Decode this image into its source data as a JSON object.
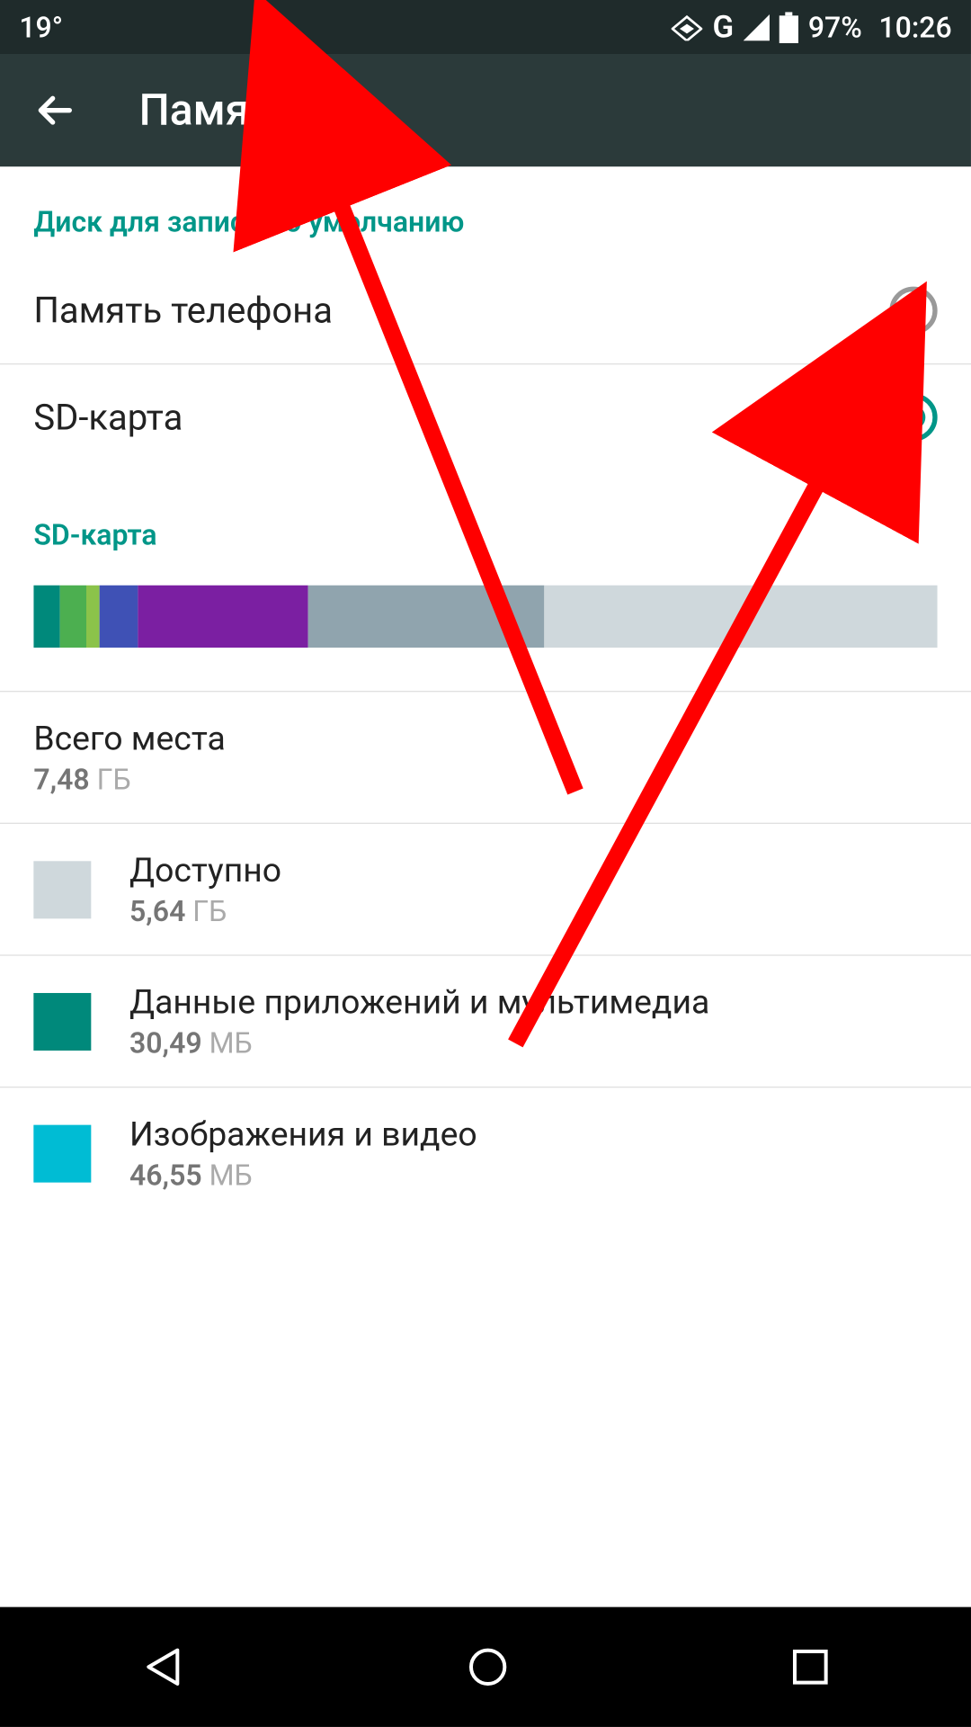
{
  "status": {
    "temperature": "19°",
    "battery_pct": "97%",
    "time": "10:26"
  },
  "header": {
    "title": "Память"
  },
  "default_disk": {
    "section_title": "Диск для записи по умолчанию",
    "option_phone": "Память телефона",
    "option_sd": "SD-карта",
    "selected": "sd"
  },
  "sd_card": {
    "section_title": "SD-карта",
    "segments": [
      {
        "color": "#00897b",
        "flex": 2
      },
      {
        "color": "#4caf50",
        "flex": 2
      },
      {
        "color": "#8bc34a",
        "flex": 1
      },
      {
        "color": "#3f51b5",
        "flex": 3
      },
      {
        "color": "#7b1fa2",
        "flex": 13
      },
      {
        "color": "#90a4ae",
        "flex": 18
      },
      {
        "color": "#cfd8dc",
        "flex": 30
      }
    ],
    "total": {
      "label": "Всего места",
      "value": "7,48",
      "unit": "ГБ"
    },
    "rows": [
      {
        "swatch": "#cfd8dc",
        "label": "Доступно",
        "value": "5,64",
        "unit": "ГБ"
      },
      {
        "swatch": "#00897b",
        "label": "Данные приложений и мультимедиа",
        "value": "30,49",
        "unit": "МБ"
      },
      {
        "swatch": "#00bcd4",
        "label": "Изображения и видео",
        "value": "46,55",
        "unit": "МБ"
      }
    ]
  }
}
